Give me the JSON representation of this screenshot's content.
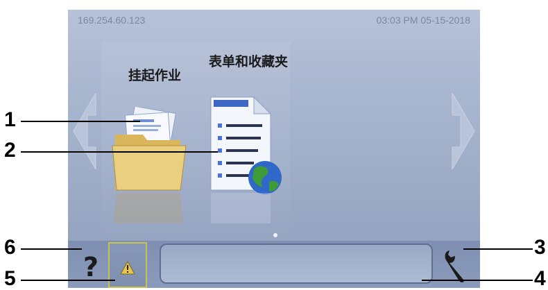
{
  "status_bar": {
    "ip_address": "169.254.60.123",
    "datetime": "03:03 PM 05-15-2018"
  },
  "apps": [
    {
      "label": "挂起作业",
      "icon": "folder-icon"
    },
    {
      "label": "表单和收藏夹",
      "icon": "forms-globe-icon"
    }
  ],
  "bottom_bar": {
    "help_label": "?",
    "warning_icon": "warning-icon",
    "settings_icon": "wrench-icon"
  },
  "callouts": [
    "1",
    "2",
    "3",
    "4",
    "5",
    "6"
  ],
  "colors": {
    "accent_warning": "#c8c34a",
    "screen_bg": "#a9b6cf"
  }
}
